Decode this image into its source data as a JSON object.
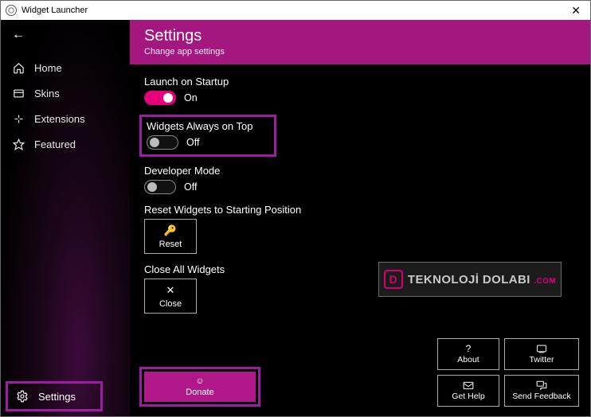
{
  "window": {
    "title": "Widget Launcher"
  },
  "sidebar": {
    "items": [
      {
        "label": "Home"
      },
      {
        "label": "Skins"
      },
      {
        "label": "Extensions"
      },
      {
        "label": "Featured"
      }
    ],
    "settings_label": "Settings"
  },
  "header": {
    "title": "Settings",
    "subtitle": "Change app settings"
  },
  "settings": {
    "launch_startup": {
      "label": "Launch on Startup",
      "state": "On"
    },
    "always_top": {
      "label": "Widgets Always on Top",
      "state": "Off"
    },
    "dev_mode": {
      "label": "Developer Mode",
      "state": "Off"
    },
    "reset": {
      "label": "Reset Widgets to Starting Position",
      "button": "Reset"
    },
    "close_all": {
      "label": "Close All Widgets",
      "button": "Close"
    }
  },
  "footer": {
    "about": "About",
    "twitter": "Twitter",
    "get_help": "Get Help",
    "send_feedback": "Send Feedback",
    "donate": "Donate"
  },
  "watermark": {
    "text": "TEKNOLOJİ DOLABI",
    "suffix": ".COM"
  }
}
